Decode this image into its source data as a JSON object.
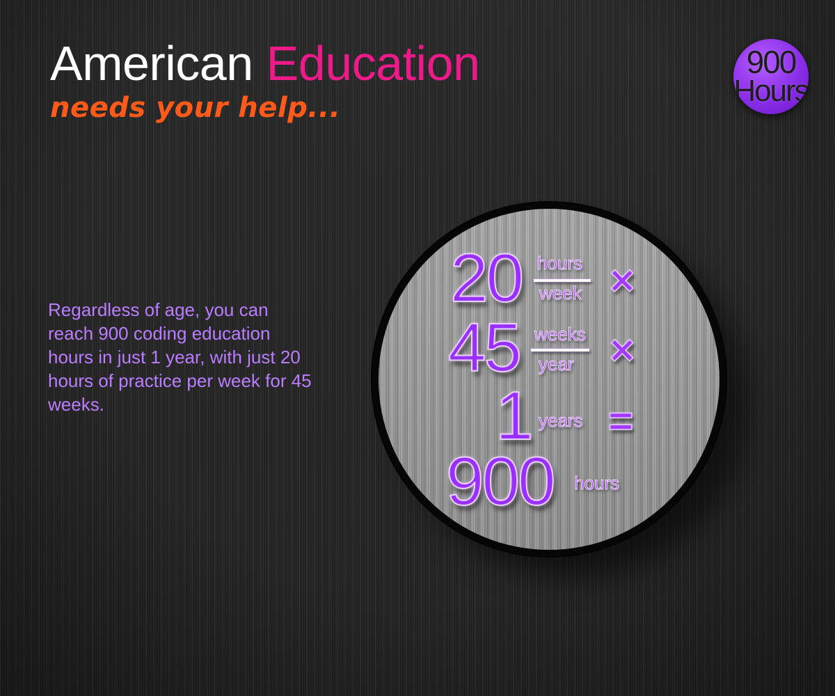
{
  "header": {
    "title_part1": "American",
    "title_part2": "Education",
    "subtitle": "needs your help..."
  },
  "badge": {
    "line1": "900",
    "line2": "Hours"
  },
  "description": "Regardless of age, you can reach 900 coding education hours in just 1 year, with just 20 hours of practice per week for 45 weeks.",
  "equation": {
    "row1": {
      "value": "20",
      "unit_top": "hours",
      "unit_bottom": "week",
      "operator": "×"
    },
    "row2": {
      "value": "45",
      "unit_top": "weeks",
      "unit_bottom": "year",
      "operator": "×"
    },
    "row3": {
      "value": "1",
      "unit": "years",
      "operator": "="
    },
    "result": {
      "value": "900",
      "unit": "hours"
    }
  },
  "colors": {
    "accent_pink": "#ee1a8a",
    "accent_orange": "#ff5a1a",
    "accent_purple": "#9a30ff",
    "text_lavender": "#bb7dff",
    "background": "#2a2a2a"
  }
}
